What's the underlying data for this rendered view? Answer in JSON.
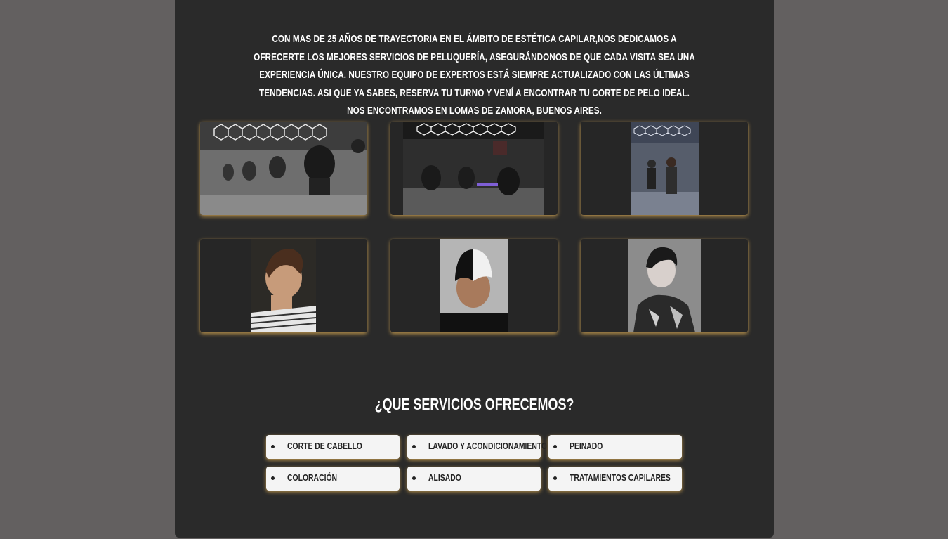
{
  "intro": {
    "text": "Con mas de 25 años de trayectoria en el ámbito de estética capilar,nos dedicamos a ofrecerte los mejores servicios de peluquería, asegurándonos de que cada visita sea una experiencia única. Nuestro equipo de expertos está siempre actualizado con las últimas tendencias. Asi que ya sabes, reserva tu turno y vení a encontrar tu corte de pelo ideal. Nos encontramos en Lomas de Zamora, Buenos Aires."
  },
  "gallery": {
    "items": [
      {
        "label": "salon-interior-photo"
      },
      {
        "label": "salon-hexagon-lights-photo"
      },
      {
        "label": "barbers-group-photo"
      },
      {
        "label": "haircut-side-photo"
      },
      {
        "label": "two-tone-hair-photo"
      },
      {
        "label": "client-portrait-photo"
      }
    ]
  },
  "services": {
    "heading": "¿Que servicios ofrecemos?",
    "items": [
      {
        "label": "Corte de cabello"
      },
      {
        "label": "Lavado y acondicionamiento"
      },
      {
        "label": "Peinado"
      },
      {
        "label": "Coloración"
      },
      {
        "label": "Alisado"
      },
      {
        "label": "Tratamientos capilares"
      }
    ]
  },
  "colors": {
    "page_bg": "#636060",
    "panel_bg": "#2a2a2a",
    "accent_glow": "#d6a854",
    "card_bg": "#f4f4f4"
  }
}
